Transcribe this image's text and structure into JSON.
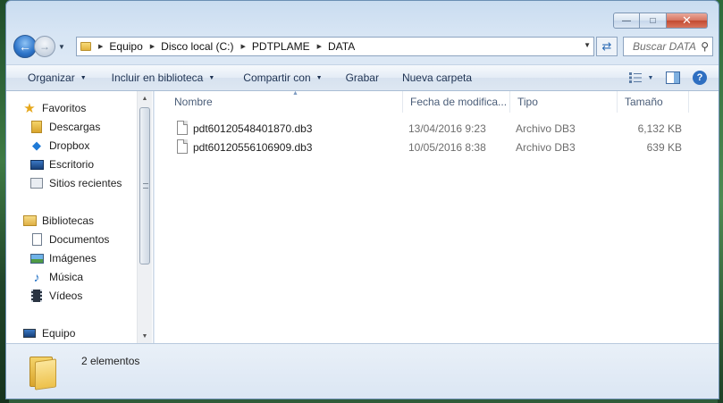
{
  "window": {
    "caption": {
      "minimize": "—",
      "maximize": "□",
      "close": "✕"
    }
  },
  "navigation": {
    "back_glyph": "←",
    "forward_glyph": "→"
  },
  "address_bar": {
    "breadcrumbs": [
      "Equipo",
      "Disco local (C:)",
      "PDTPLAME",
      "DATA"
    ]
  },
  "search": {
    "placeholder": "Buscar DATA"
  },
  "toolbar": {
    "organize": "Organizar",
    "include_library": "Incluir en biblioteca",
    "share_with": "Compartir con",
    "burn": "Grabar",
    "new_folder": "Nueva carpeta",
    "help_glyph": "?"
  },
  "nav_pane": {
    "favorites": {
      "label": "Favoritos",
      "icon": "star-icon"
    },
    "favorites_items": [
      {
        "label": "Descargas",
        "icon": "downloads-folder-icon"
      },
      {
        "label": "Dropbox",
        "icon": "dropbox-icon"
      },
      {
        "label": "Escritorio",
        "icon": "desktop-icon"
      },
      {
        "label": "Sitios recientes",
        "icon": "recent-places-icon"
      }
    ],
    "libraries": {
      "label": "Bibliotecas",
      "icon": "libraries-icon"
    },
    "libraries_items": [
      {
        "label": "Documentos",
        "icon": "documents-icon"
      },
      {
        "label": "Imágenes",
        "icon": "pictures-icon"
      },
      {
        "label": "Música",
        "icon": "music-icon"
      },
      {
        "label": "Vídeos",
        "icon": "videos-icon"
      }
    ],
    "computer": {
      "label": "Equipo",
      "icon": "computer-icon"
    }
  },
  "file_list": {
    "columns": {
      "name": "Nombre",
      "date": "Fecha de modifica...",
      "type": "Tipo",
      "size": "Tamaño"
    },
    "files": [
      {
        "name": "pdt60120548401870.db3",
        "date": "13/04/2016 9:23",
        "type": "Archivo DB3",
        "size": "6,132 KB"
      },
      {
        "name": "pdt60120556106909.db3",
        "date": "10/05/2016 8:38",
        "type": "Archivo DB3",
        "size": "639 KB"
      }
    ]
  },
  "details_pane": {
    "item_count": "2 elementos"
  }
}
